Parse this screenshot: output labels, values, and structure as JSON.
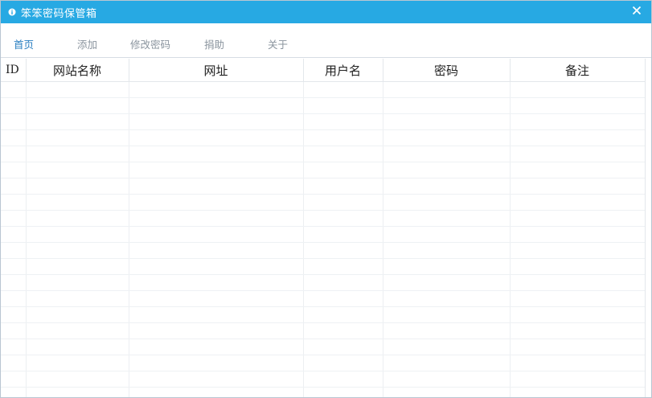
{
  "window": {
    "title": "笨笨密码保管箱",
    "accent_color": "#27a9e3"
  },
  "icons": {
    "app": "info-circle-icon",
    "close": "close-icon"
  },
  "menu": {
    "items": [
      {
        "label": "首页",
        "active": true
      },
      {
        "label": "添加",
        "active": false
      },
      {
        "label": "修改密码",
        "active": false
      },
      {
        "label": "捐助",
        "active": false
      },
      {
        "label": "关于",
        "active": false
      }
    ]
  },
  "table": {
    "columns": [
      "ID",
      "网站名称",
      "网址",
      "用户名",
      "密码",
      "备注"
    ],
    "rows": []
  }
}
